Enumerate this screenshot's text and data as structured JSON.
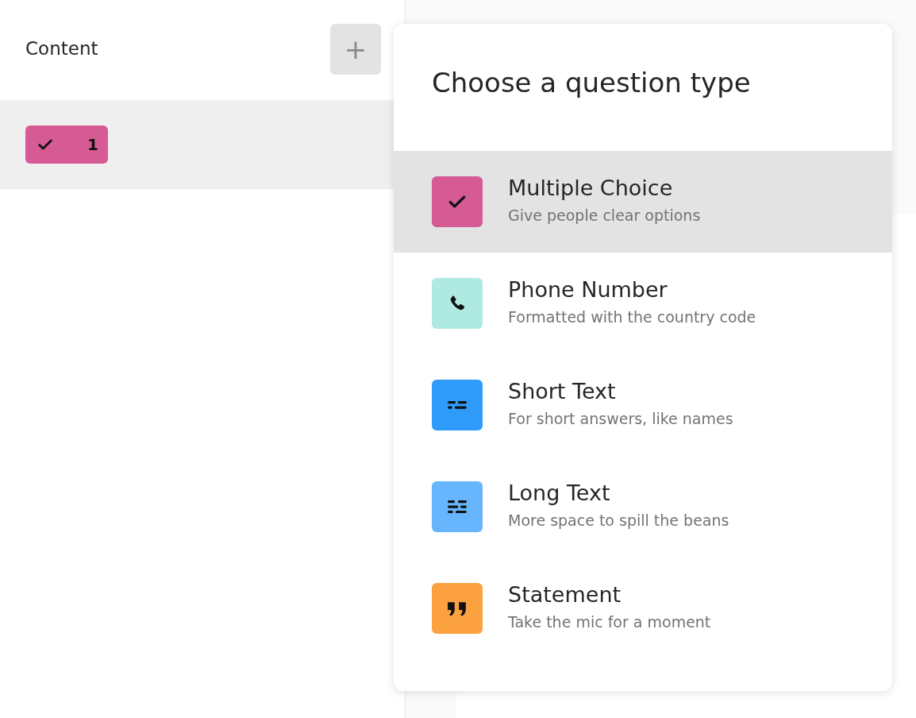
{
  "sidebar": {
    "title": "Content",
    "add_button": "+",
    "items": [
      {
        "kind": "multiple_choice",
        "number": "1",
        "color": "#d65b95",
        "selected": true
      }
    ]
  },
  "popup": {
    "title": "Choose a question type",
    "options": [
      {
        "kind": "multiple_choice",
        "label": "Multiple Choice",
        "description": "Give people clear options",
        "color": "#d65b95",
        "selected": true
      },
      {
        "kind": "phone",
        "label": "Phone Number",
        "description": "Formatted with the country code",
        "color": "#aeeae1",
        "selected": false
      },
      {
        "kind": "short_text",
        "label": "Short Text",
        "description": "For short answers, like names",
        "color": "#2f9bfb",
        "selected": false
      },
      {
        "kind": "long_text",
        "label": "Long Text",
        "description": "More space to spill the beans",
        "color": "#66b5fd",
        "selected": false
      },
      {
        "kind": "statement",
        "label": "Statement",
        "description": "Take the mic for a moment",
        "color": "#fba13f",
        "selected": false
      }
    ]
  }
}
